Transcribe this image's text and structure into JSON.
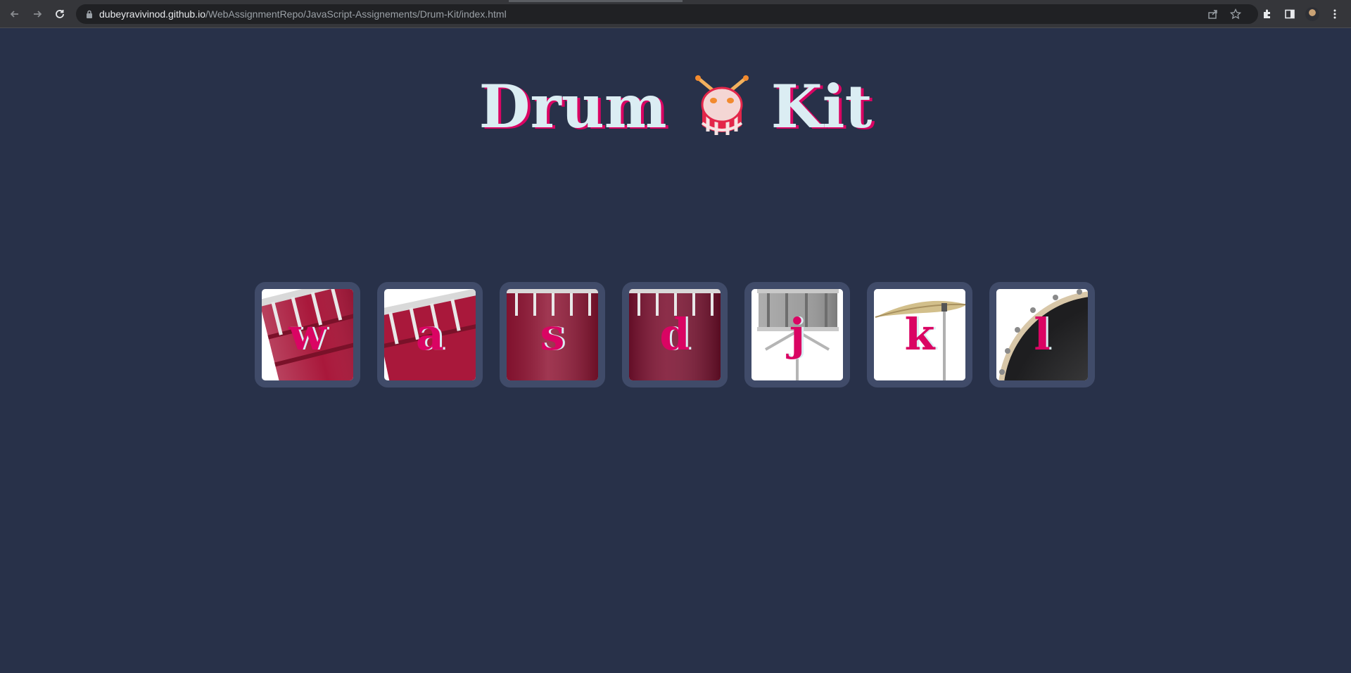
{
  "browser": {
    "url_host": "dubeyravivinod.github.io",
    "url_path": "/WebAssignmentRepo/JavaScript-Assignements/Drum-Kit/index.html"
  },
  "page": {
    "title_word_1": "Drum",
    "title_word_2": "Kit",
    "background_color": "#283149",
    "accent_color": "#da0463",
    "title_color": "#dbedf3",
    "tile_border_color": "#404b69"
  },
  "drums": [
    {
      "key": "w",
      "instrument": "tom-1"
    },
    {
      "key": "a",
      "instrument": "tom-2"
    },
    {
      "key": "s",
      "instrument": "tom-3"
    },
    {
      "key": "d",
      "instrument": "tom-4"
    },
    {
      "key": "j",
      "instrument": "snare"
    },
    {
      "key": "k",
      "instrument": "crash"
    },
    {
      "key": "l",
      "instrument": "kick-bass"
    }
  ]
}
